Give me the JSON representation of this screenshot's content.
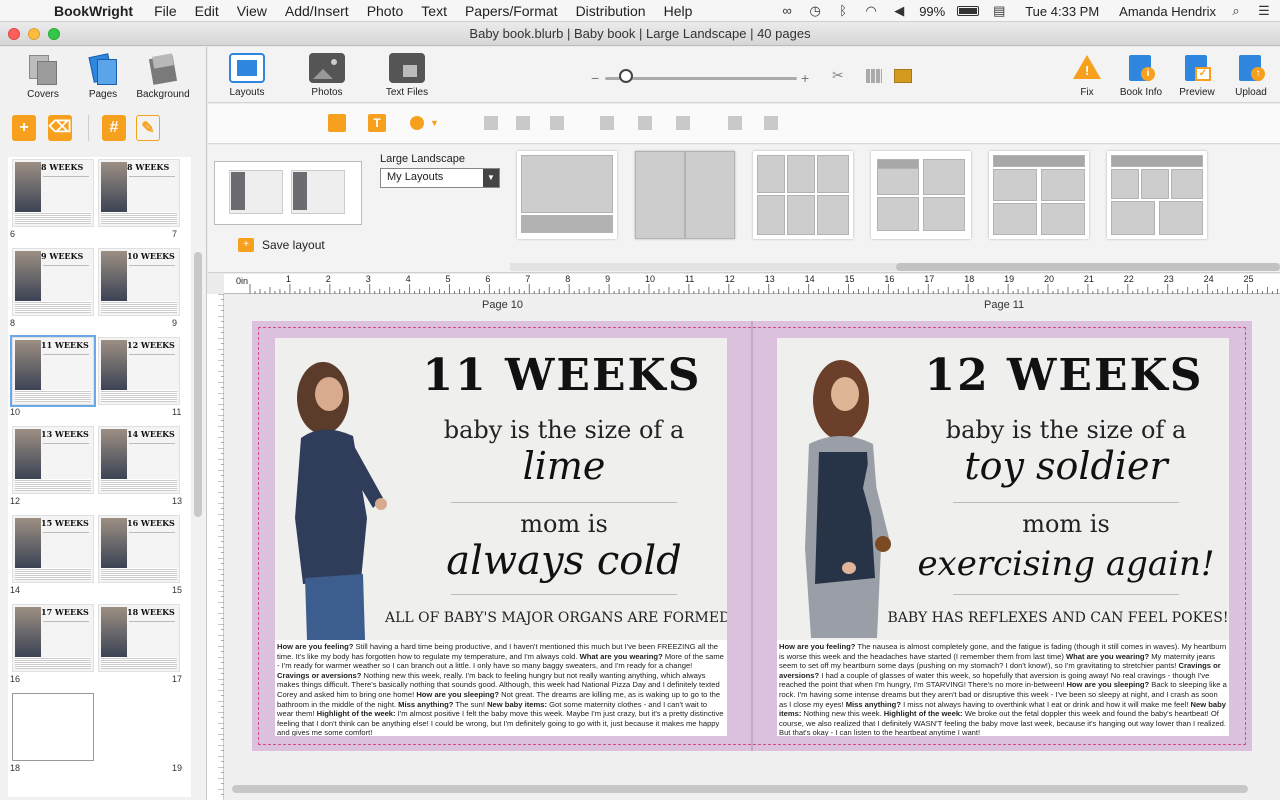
{
  "menubar": {
    "app": "BookWright",
    "items": [
      "File",
      "Edit",
      "View",
      "Add/Insert",
      "Photo",
      "Text",
      "Papers/Format",
      "Distribution",
      "Help"
    ],
    "battery": "99%",
    "clock": "Tue 4:33 PM",
    "user": "Amanda Hendrix"
  },
  "window": {
    "title": "Baby book.blurb | Baby book | Large Landscape | 40 pages"
  },
  "left_tools": {
    "covers": "Covers",
    "pages": "Pages",
    "background": "Background"
  },
  "thumbnails": [
    {
      "left_title": "8 WEEKS",
      "right_title": "8 WEEKS",
      "left_num": "6",
      "right_num": "7"
    },
    {
      "left_title": "9 WEEKS",
      "right_title": "10 WEEKS",
      "left_num": "8",
      "right_num": "9"
    },
    {
      "left_title": "11 WEEKS",
      "right_title": "12 WEEKS",
      "left_num": "10",
      "right_num": "11"
    },
    {
      "left_title": "13 WEEKS",
      "right_title": "14 WEEKS",
      "left_num": "12",
      "right_num": "13"
    },
    {
      "left_title": "15 WEEKS",
      "right_title": "16 WEEKS",
      "left_num": "14",
      "right_num": "15"
    },
    {
      "left_title": "17 WEEKS",
      "right_title": "18 WEEKS",
      "left_num": "16",
      "right_num": "17"
    },
    {
      "left_title": "",
      "right_title": "",
      "left_num": "18",
      "right_num": "19"
    }
  ],
  "toolbar": {
    "layouts": "Layouts",
    "photos": "Photos",
    "text_files": "Text Files",
    "fix": "Fix",
    "book_info": "Book Info",
    "preview": "Preview",
    "upload": "Upload"
  },
  "layouts_panel": {
    "format": "Large Landscape",
    "select_value": "My Layouts",
    "save_layout": "Save layout"
  },
  "ruler": {
    "origin": "0in",
    "ticks": [
      "1",
      "2",
      "3",
      "4",
      "5",
      "6",
      "7",
      "8",
      "9",
      "10",
      "11",
      "12",
      "13",
      "14",
      "15",
      "16",
      "17",
      "18",
      "19",
      "20",
      "21",
      "22",
      "23",
      "24",
      "25"
    ]
  },
  "pages": {
    "left": {
      "label": "Page 10",
      "title": "11 WEEKS",
      "size_line": "baby is the size of a",
      "fruit": "lime",
      "mom_line": "mom is",
      "mom_state": "always cold",
      "caption": "ALL OF BABY'S MAJOR ORGANS ARE FORMED!",
      "body": [
        {
          "b": "How are you feeling?"
        },
        {
          "t": " Still having a hard time being productive, and I haven't mentioned this much but I've been FREEZING all the time. It's like my body has forgotten how to regulate my temperature, and I'm always cold. "
        },
        {
          "b": "What are you wearing?"
        },
        {
          "t": " More of the same - I'm ready for warmer weather so I can branch out a little. I only have so many baggy sweaters, and I'm ready for a change! "
        },
        {
          "b": "Cravings or aversions?"
        },
        {
          "t": " Nothing new this week, really. I'm back to feeling hungry but not really wanting anything, which always makes things difficult. There's basically nothing that sounds good. Although, this week had National Pizza Day and I definitely texted Corey and asked him to bring one home! "
        },
        {
          "b": "How are you sleeping?"
        },
        {
          "t": " Not great. The dreams are killing me, as is waking up to go to the bathroom in the middle of the night. "
        },
        {
          "b": "Miss anything?"
        },
        {
          "t": " The sun! "
        },
        {
          "b": "New baby items:"
        },
        {
          "t": " Got some maternity clothes - and I can't wait to wear them! "
        },
        {
          "b": "Highlight of the week:"
        },
        {
          "t": " I'm almost positive I felt the baby move this week. Maybe I'm just crazy, but it's a pretty distinctive feeling that I don't think can be anything else! I could be wrong, but I'm definitely going to go with it, just because it makes me happy and gives me some comfort!"
        }
      ]
    },
    "right": {
      "label": "Page 11",
      "title": "12 WEEKS",
      "size_line": "baby is the size of a",
      "fruit": "toy soldier",
      "mom_line": "mom is",
      "mom_state": "exercising again!",
      "caption": "BABY HAS REFLEXES AND CAN FEEL POKES!",
      "body": [
        {
          "b": "How are you feeling?"
        },
        {
          "t": " The nausea is almost completely gone, and the fatigue is fading (though it still comes in waves). My heartburn is worse this week and the headaches have started (I remember them from last time) "
        },
        {
          "b": "What are you wearing?"
        },
        {
          "t": " My maternity jeans seem to set off my heartburn some days (pushing on my stomach? I don't know!), so I'm gravitating to stretchier pants! "
        },
        {
          "b": "Cravings or aversions?"
        },
        {
          "t": " I had a couple of glasses of water this week, so hopefully that aversion is going away! No real cravings - though I've reached the point that when I'm hungry, I'm STARVING! There's no more in-between! "
        },
        {
          "b": "How are you sleeping?"
        },
        {
          "t": " Back to sleeping like a rock. I'm having some intense dreams but they aren't bad or disruptive this week - I've been so sleepy at night, and I crash as soon as I close my eyes! "
        },
        {
          "b": "Miss anything?"
        },
        {
          "t": " I miss not always having to overthink what I eat or drink and how it will make me feel! "
        },
        {
          "b": "New baby items:"
        },
        {
          "t": " Nothing new this week. "
        },
        {
          "b": "Highlight of the week:"
        },
        {
          "t": " We broke out the fetal doppler this week and found the baby's heartbeat! Of course, we also realized that I definitely WASN'T feeling the baby move last week, because it's hanging out way lower than I realized. But that's okay - I can listen to the heartbeat anytime I want!"
        }
      ]
    }
  },
  "colors": {
    "accent_orange": "#f7a01d",
    "accent_blue": "#2e86de",
    "spread_bleed": "#dcc1de"
  }
}
